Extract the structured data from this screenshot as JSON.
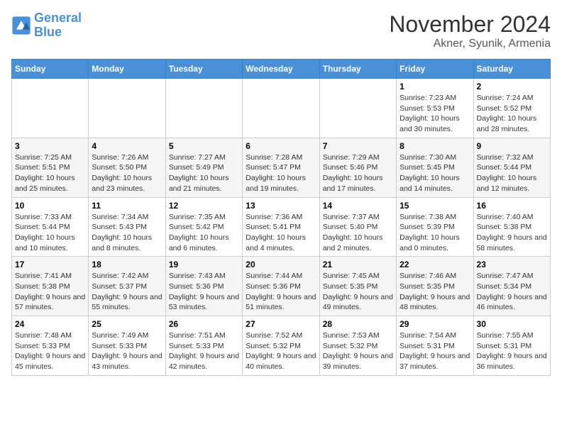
{
  "header": {
    "logo_line1": "General",
    "logo_line2": "Blue",
    "month": "November 2024",
    "location": "Akner, Syunik, Armenia"
  },
  "weekdays": [
    "Sunday",
    "Monday",
    "Tuesday",
    "Wednesday",
    "Thursday",
    "Friday",
    "Saturday"
  ],
  "weeks": [
    [
      {
        "day": "",
        "info": ""
      },
      {
        "day": "",
        "info": ""
      },
      {
        "day": "",
        "info": ""
      },
      {
        "day": "",
        "info": ""
      },
      {
        "day": "",
        "info": ""
      },
      {
        "day": "1",
        "info": "Sunrise: 7:23 AM\nSunset: 5:53 PM\nDaylight: 10 hours and 30 minutes."
      },
      {
        "day": "2",
        "info": "Sunrise: 7:24 AM\nSunset: 5:52 PM\nDaylight: 10 hours and 28 minutes."
      }
    ],
    [
      {
        "day": "3",
        "info": "Sunrise: 7:25 AM\nSunset: 5:51 PM\nDaylight: 10 hours and 25 minutes."
      },
      {
        "day": "4",
        "info": "Sunrise: 7:26 AM\nSunset: 5:50 PM\nDaylight: 10 hours and 23 minutes."
      },
      {
        "day": "5",
        "info": "Sunrise: 7:27 AM\nSunset: 5:49 PM\nDaylight: 10 hours and 21 minutes."
      },
      {
        "day": "6",
        "info": "Sunrise: 7:28 AM\nSunset: 5:47 PM\nDaylight: 10 hours and 19 minutes."
      },
      {
        "day": "7",
        "info": "Sunrise: 7:29 AM\nSunset: 5:46 PM\nDaylight: 10 hours and 17 minutes."
      },
      {
        "day": "8",
        "info": "Sunrise: 7:30 AM\nSunset: 5:45 PM\nDaylight: 10 hours and 14 minutes."
      },
      {
        "day": "9",
        "info": "Sunrise: 7:32 AM\nSunset: 5:44 PM\nDaylight: 10 hours and 12 minutes."
      }
    ],
    [
      {
        "day": "10",
        "info": "Sunrise: 7:33 AM\nSunset: 5:44 PM\nDaylight: 10 hours and 10 minutes."
      },
      {
        "day": "11",
        "info": "Sunrise: 7:34 AM\nSunset: 5:43 PM\nDaylight: 10 hours and 8 minutes."
      },
      {
        "day": "12",
        "info": "Sunrise: 7:35 AM\nSunset: 5:42 PM\nDaylight: 10 hours and 6 minutes."
      },
      {
        "day": "13",
        "info": "Sunrise: 7:36 AM\nSunset: 5:41 PM\nDaylight: 10 hours and 4 minutes."
      },
      {
        "day": "14",
        "info": "Sunrise: 7:37 AM\nSunset: 5:40 PM\nDaylight: 10 hours and 2 minutes."
      },
      {
        "day": "15",
        "info": "Sunrise: 7:38 AM\nSunset: 5:39 PM\nDaylight: 10 hours and 0 minutes."
      },
      {
        "day": "16",
        "info": "Sunrise: 7:40 AM\nSunset: 5:38 PM\nDaylight: 9 hours and 58 minutes."
      }
    ],
    [
      {
        "day": "17",
        "info": "Sunrise: 7:41 AM\nSunset: 5:38 PM\nDaylight: 9 hours and 57 minutes."
      },
      {
        "day": "18",
        "info": "Sunrise: 7:42 AM\nSunset: 5:37 PM\nDaylight: 9 hours and 55 minutes."
      },
      {
        "day": "19",
        "info": "Sunrise: 7:43 AM\nSunset: 5:36 PM\nDaylight: 9 hours and 53 minutes."
      },
      {
        "day": "20",
        "info": "Sunrise: 7:44 AM\nSunset: 5:36 PM\nDaylight: 9 hours and 51 minutes."
      },
      {
        "day": "21",
        "info": "Sunrise: 7:45 AM\nSunset: 5:35 PM\nDaylight: 9 hours and 49 minutes."
      },
      {
        "day": "22",
        "info": "Sunrise: 7:46 AM\nSunset: 5:35 PM\nDaylight: 9 hours and 48 minutes."
      },
      {
        "day": "23",
        "info": "Sunrise: 7:47 AM\nSunset: 5:34 PM\nDaylight: 9 hours and 46 minutes."
      }
    ],
    [
      {
        "day": "24",
        "info": "Sunrise: 7:48 AM\nSunset: 5:33 PM\nDaylight: 9 hours and 45 minutes."
      },
      {
        "day": "25",
        "info": "Sunrise: 7:49 AM\nSunset: 5:33 PM\nDaylight: 9 hours and 43 minutes."
      },
      {
        "day": "26",
        "info": "Sunrise: 7:51 AM\nSunset: 5:33 PM\nDaylight: 9 hours and 42 minutes."
      },
      {
        "day": "27",
        "info": "Sunrise: 7:52 AM\nSunset: 5:32 PM\nDaylight: 9 hours and 40 minutes."
      },
      {
        "day": "28",
        "info": "Sunrise: 7:53 AM\nSunset: 5:32 PM\nDaylight: 9 hours and 39 minutes."
      },
      {
        "day": "29",
        "info": "Sunrise: 7:54 AM\nSunset: 5:31 PM\nDaylight: 9 hours and 37 minutes."
      },
      {
        "day": "30",
        "info": "Sunrise: 7:55 AM\nSunset: 5:31 PM\nDaylight: 9 hours and 36 minutes."
      }
    ]
  ]
}
